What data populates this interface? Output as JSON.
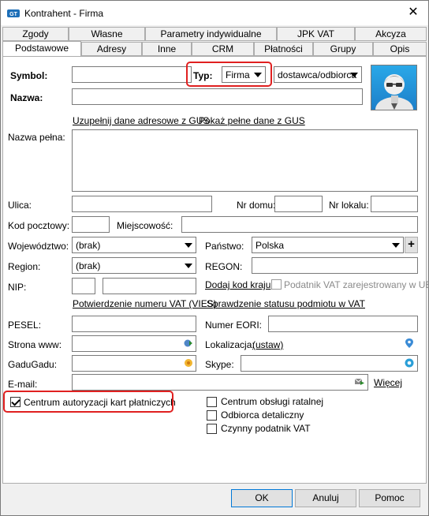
{
  "window": {
    "title": "Kontrahent - Firma",
    "close_glyph": "✕"
  },
  "tabs_row1": [
    "Zgody",
    "Własne",
    "Parametry indywidualne",
    "JPK VAT",
    "Akcyza"
  ],
  "tabs_row2": [
    "Podstawowe",
    "Adresy",
    "Inne",
    "CRM",
    "Płatności",
    "Grupy",
    "Opis"
  ],
  "form": {
    "symbol_label": "Symbol:",
    "typ_label": "Typ:",
    "typ_value": "Firma",
    "role_value": "dostawca/odbiorca",
    "nazwa_label": "Nazwa:",
    "gus_link": "Uzupełnij dane adresowe z GUS",
    "gus_show_link": "Pokaż pełne dane z GUS",
    "nazwa_pelna_label": "Nazwa pełna:",
    "ulica_label": "Ulica:",
    "nr_domu_label": "Nr domu:",
    "nr_lokalu_label": "Nr lokalu:",
    "kod_label": "Kod pocztowy:",
    "miejscowosc_label": "Miejscowość:",
    "wojewodztwo_label": "Województwo:",
    "wojewodztwo_value": "(brak)",
    "panstwo_label": "Państwo:",
    "panstwo_value": "Polska",
    "add_glyph": "+",
    "region_label": "Region:",
    "region_value": "(brak)",
    "regon_label": "REGON:",
    "nip_label": "NIP:",
    "dodaj_kod_link": "Dodaj kod kraju",
    "vat_ue_label": "Podatnik VAT zarejestrowany w UE",
    "vies_link": "Potwierdzenie numeru VAT (VIES)",
    "status_vat_link": "Sprawdzenie statusu podmiotu w VAT",
    "pesel_label": "PESEL:",
    "eori_label": "Numer EORI:",
    "www_label": "Strona www:",
    "lokalizacja_label": "Lokalizacja:",
    "ustaw_link": "(ustaw)",
    "gadu_label": "GaduGadu:",
    "skype_label": "Skype:",
    "email_label": "E-mail:",
    "wiecej_link": "Więcej",
    "centrum_karty_label": "Centrum autoryzacji kart płatniczych",
    "centrum_ratalne_label": "Centrum obsługi ratalnej",
    "odbiorca_label": "Odbiorca detaliczny",
    "czynny_label": "Czynny podatnik VAT"
  },
  "buttons": {
    "ok": "OK",
    "anuluj": "Anuluj",
    "pomoc": "Pomoc"
  },
  "colors": {
    "highlight": "#e02020",
    "avatar_bg": "#2aa8e8",
    "link": "#000000"
  }
}
